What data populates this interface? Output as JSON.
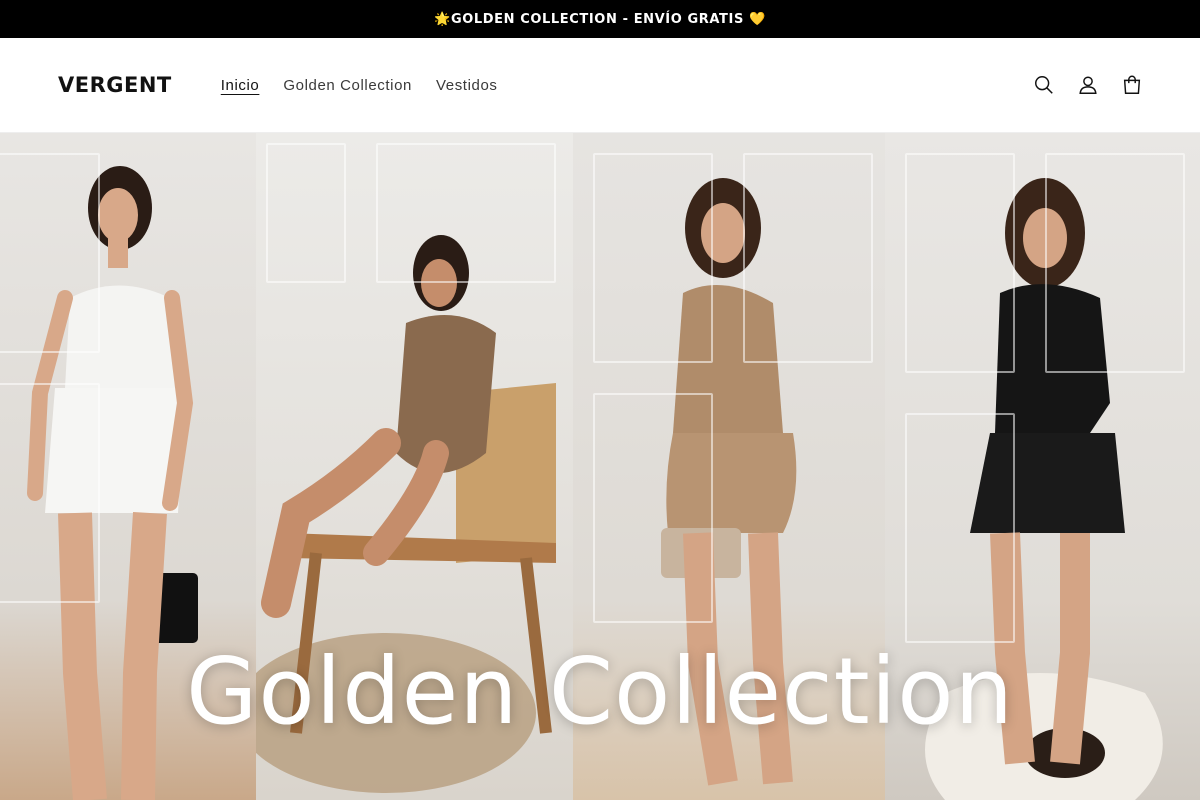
{
  "announcement": {
    "text": "🌟GOLDEN COLLECTION - ENVÍO GRATIS 💛"
  },
  "header": {
    "logo": "VERGENT",
    "nav": [
      {
        "label": "Inicio",
        "active": true
      },
      {
        "label": "Golden Collection",
        "active": false
      },
      {
        "label": "Vestidos",
        "active": false
      }
    ],
    "icons": [
      "search-icon",
      "account-icon",
      "cart-icon"
    ]
  },
  "hero": {
    "title": "Golden Collection",
    "panels": [
      {
        "name": "model-white-corset-outfit",
        "dress_color": "#f4f4f2"
      },
      {
        "name": "model-bronze-mesh-on-chair",
        "dress_color": "#8a6a4e"
      },
      {
        "name": "model-gold-metallic-dress",
        "dress_color": "#b08c6a"
      },
      {
        "name": "model-black-halter-dress",
        "dress_color": "#151515"
      }
    ]
  },
  "colors": {
    "announcement_bg": "#000000",
    "text": "#121212"
  }
}
